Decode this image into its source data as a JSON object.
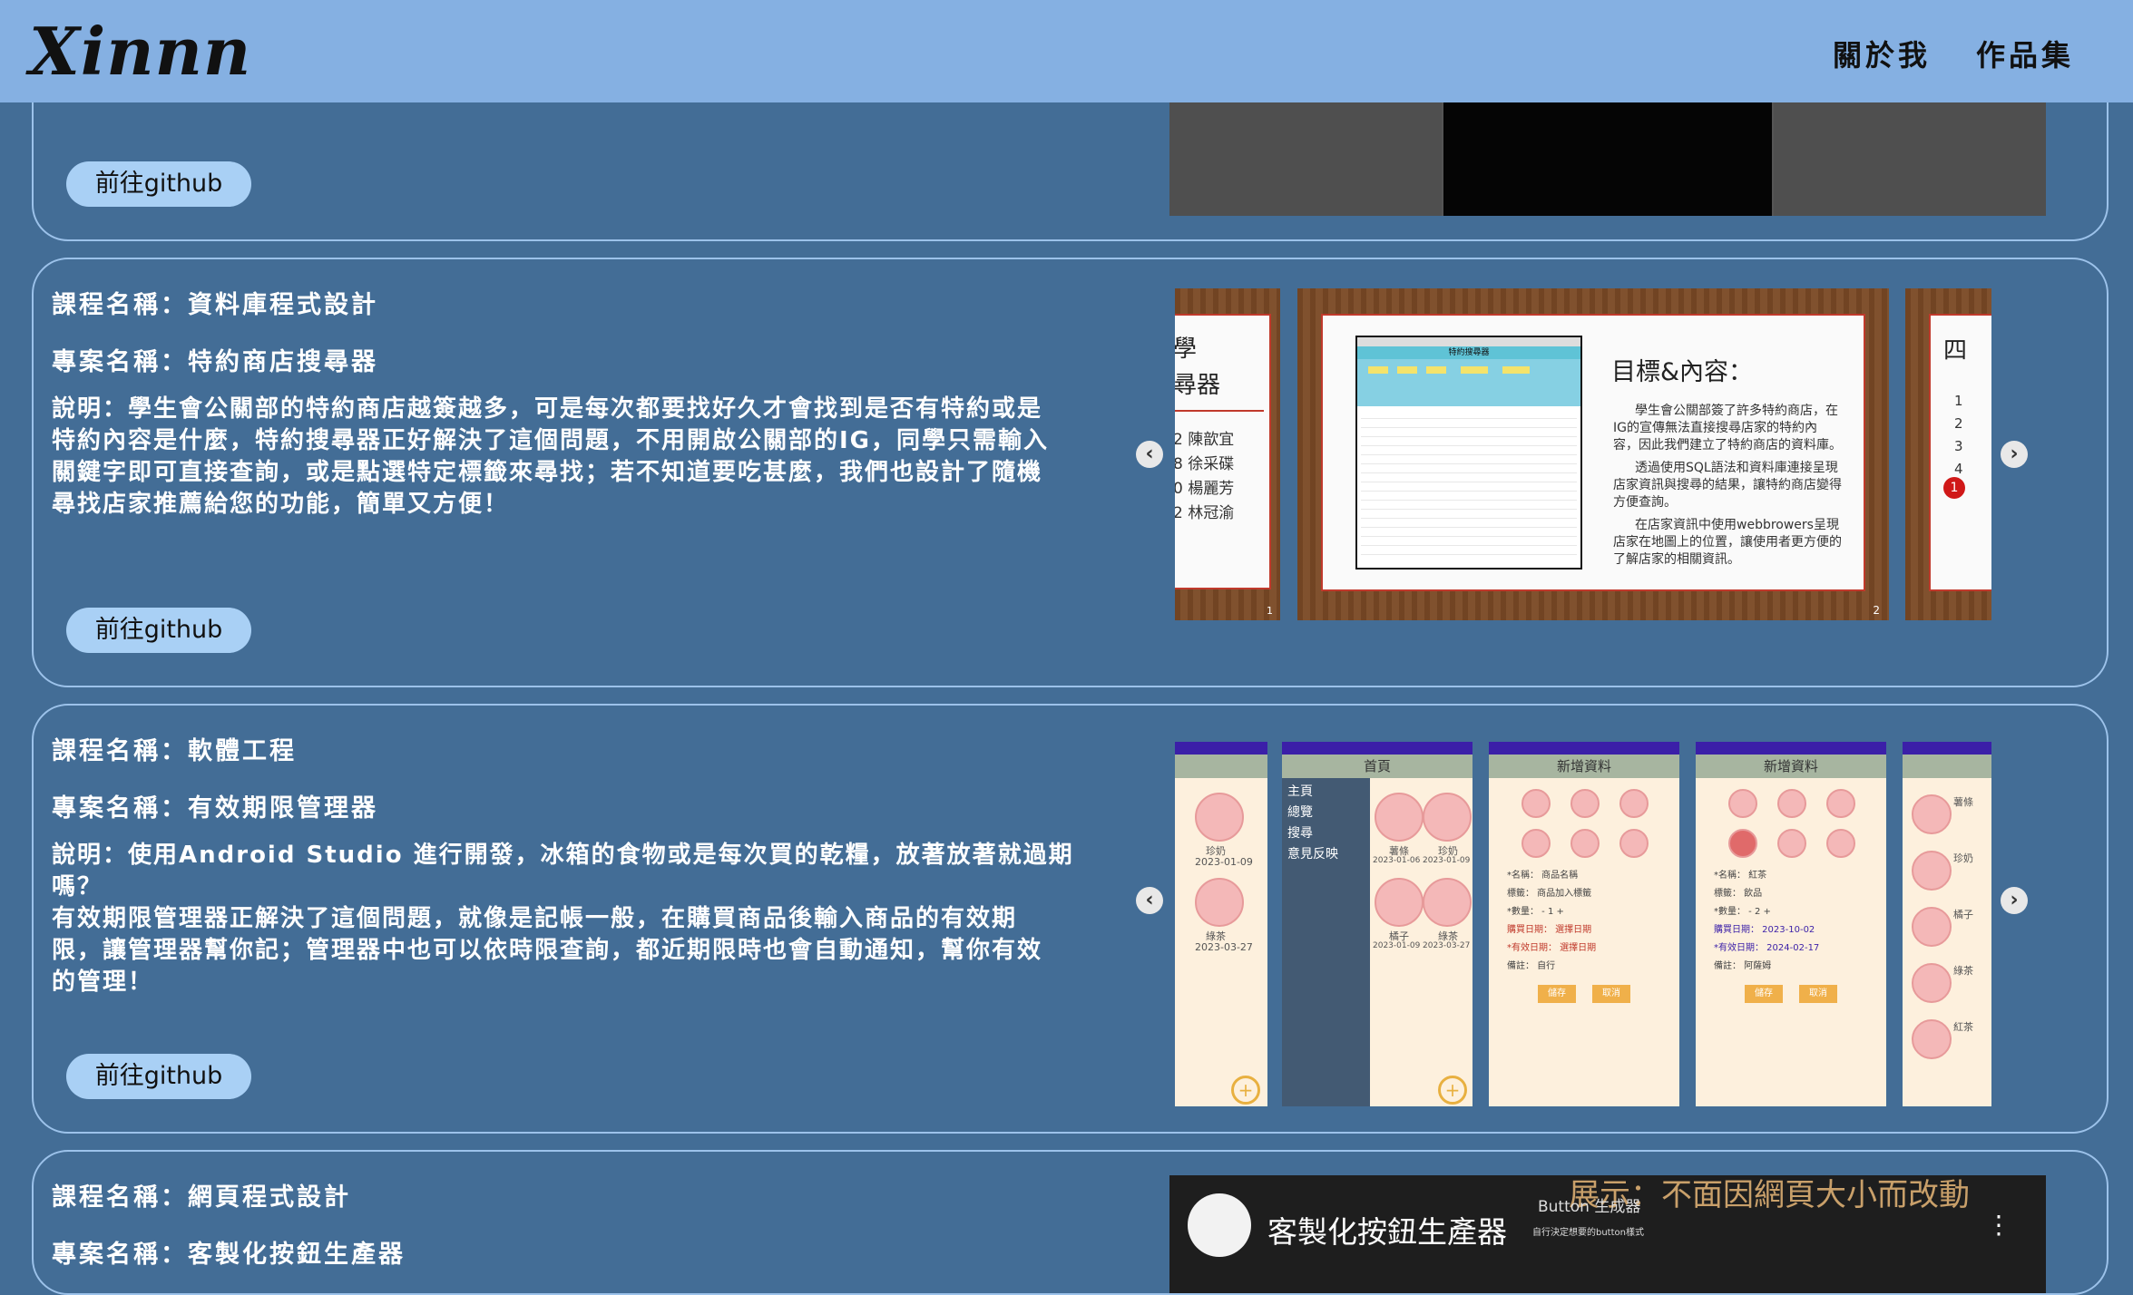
{
  "header": {
    "logo": "Xinnn",
    "nav": [
      "關於我",
      "作品集"
    ]
  },
  "cards": [
    {
      "github_label": "前往github"
    },
    {
      "course": "課程名稱：資料庫程式設計",
      "project": "專案名稱：特約商店搜尋器",
      "description": [
        "說明：學生會公關部的特約商店越簽越多，可是每次都要找好久才會找到是否有特約或是",
        "特約內容是什麼，特約搜尋器正好解決了這個問題，不用開啟公關部的IG，同學只需輸入",
        "關鍵字即可直接查詢，或是點選特定標籤來尋找；若不知道要吃甚麼，我們也設計了隨機",
        "尋找店家推薦給您的功能，簡單又方便！"
      ],
      "github_label": "前往github",
      "slides": {
        "left_title_1": "學",
        "left_title_2": "尋器",
        "left_names": [
          "2  陳歆宜",
          "8  徐采碟",
          "0  楊麗芳",
          "2  林冠渝"
        ],
        "left_number": "1",
        "main_heading": "目標&內容：",
        "main_paras": [
          "學生會公關部簽了許多特約商店，在IG的宣傳無法直接搜尋店家的特約內容，因此我們建立了特約商店的資料庫。",
          "透過使用SQL語法和資料庫連接呈現店家資訊與搜尋的結果，讓特約商店變得方便查詢。",
          "在店家資訊中使用webbrowers呈現店家在地圖上的位置，讓使用者更方便的了解店家的相關資訊。"
        ],
        "main_number": "2",
        "app_title": "特約搜尋器",
        "right_title": "四",
        "right_items": [
          "1",
          "2",
          "3",
          "4"
        ],
        "right_badge": "1"
      },
      "arrow_left": "‹",
      "arrow_right": "›"
    },
    {
      "course": "課程名稱：軟體工程",
      "project": "專案名稱：有效期限管理器",
      "description": [
        "說明：使用Android Studio 進行開發，冰箱的食物或是每次買的乾糧，放著放著就過期嗎？",
        "有效期限管理器正解決了這個問題，就像是記帳一般，在購買商品後輸入商品的有效期",
        "限，讓管理器幫你記；管理器中也可以依時限查詢，都近期限時也會自動通知，幫你有效",
        "的管理！"
      ],
      "github_label": "前往github",
      "phones": {
        "p1_items": [
          {
            "name": "珍奶",
            "date": "2023-01-09"
          },
          {
            "name": "綠茶",
            "date": "2023-03-27"
          }
        ],
        "p2_title": "首頁",
        "p2_menu": [
          "主頁",
          "總覽",
          "搜尋",
          "意見反映"
        ],
        "p2_items": [
          {
            "name": "薯條",
            "date": "2023-01-06"
          },
          {
            "name": "珍奶",
            "date": "2023-01-09"
          },
          {
            "name": "橘子",
            "date": "2023-01-09"
          },
          {
            "name": "綠茶",
            "date": "2023-03-27"
          }
        ],
        "p3_title": "新增資料",
        "p3_fields": [
          "*名稱：  商品名稱",
          "標籤：  商品加入標籤",
          "*數量：  -  1  +",
          "購買日期：  選擇日期",
          "*有效日期：  選擇日期",
          "備註：  自行"
        ],
        "p4_title": "新增資料",
        "p4_fields": [
          "*名稱：  紅茶",
          "標籤：  飲品",
          "*數量：  -  2  +",
          "購買日期：  2023-10-02",
          "*有效日期：  2024-02-17",
          "備註：  阿薩姆"
        ],
        "save": "儲存",
        "cancel": "取消",
        "p5_labels": [
          "薯條",
          "珍奶",
          "橘子",
          "綠茶",
          "紅茶"
        ]
      },
      "arrow_left": "‹",
      "arrow_right": "›"
    },
    {
      "course": "課程名稱：網頁程式設計",
      "project": "專案名稱：客製化按鈕生產器",
      "video_title": "客製化按鈕生產器",
      "video_banner": "展示：不面因網頁大小而改動",
      "video_sub": "Button 生成器",
      "video_caption": "自行決定想要的button樣式"
    }
  ],
  "colors": {
    "background": "#436d96",
    "navbar": "#85b0e2",
    "button": "#a9d0f5",
    "card_border": "#9cc2ea"
  }
}
